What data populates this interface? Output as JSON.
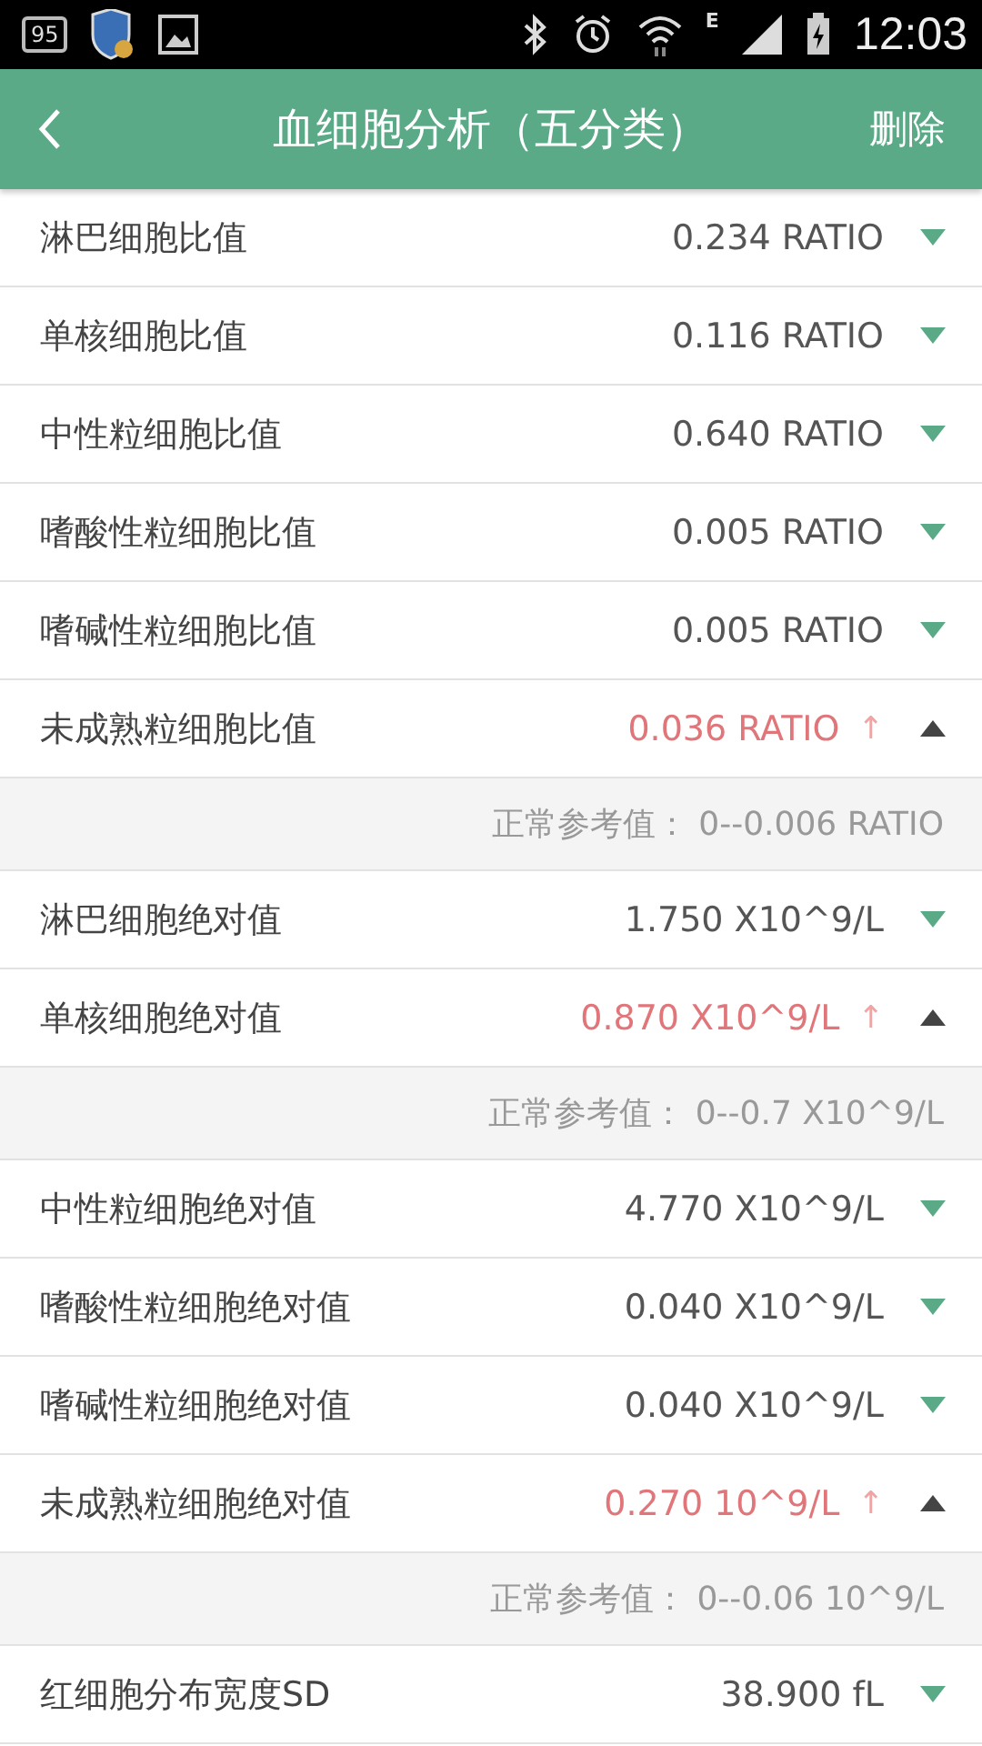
{
  "status_bar": {
    "notification_count": "95",
    "network": "E",
    "time": "12:03"
  },
  "header": {
    "title": "血细胞分析（五分类）",
    "action": "删除"
  },
  "rows": [
    {
      "name": "淋巴细胞比值",
      "value": "0.234 RATIO",
      "high": false,
      "expanded": false
    },
    {
      "name": "单核细胞比值",
      "value": "0.116 RATIO",
      "high": false,
      "expanded": false
    },
    {
      "name": "中性粒细胞比值",
      "value": "0.640 RATIO",
      "high": false,
      "expanded": false
    },
    {
      "name": "嗜酸性粒细胞比值",
      "value": "0.005 RATIO",
      "high": false,
      "expanded": false
    },
    {
      "name": "嗜碱性粒细胞比值",
      "value": "0.005 RATIO",
      "high": false,
      "expanded": false
    },
    {
      "name": "未成熟粒细胞比值",
      "value": "0.036 RATIO",
      "high": true,
      "flag": "↑",
      "expanded": true,
      "reference": "正常参考值： 0--0.006 RATIO"
    },
    {
      "name": "淋巴细胞绝对值",
      "value": "1.750 X10^9/L",
      "high": false,
      "expanded": false
    },
    {
      "name": "单核细胞绝对值",
      "value": "0.870 X10^9/L",
      "high": true,
      "flag": "↑",
      "expanded": true,
      "reference": "正常参考值： 0--0.7 X10^9/L"
    },
    {
      "name": "中性粒细胞绝对值",
      "value": "4.770 X10^9/L",
      "high": false,
      "expanded": false
    },
    {
      "name": "嗜酸性粒细胞绝对值",
      "value": "0.040 X10^9/L",
      "high": false,
      "expanded": false
    },
    {
      "name": "嗜碱性粒细胞绝对值",
      "value": "0.040 X10^9/L",
      "high": false,
      "expanded": false
    },
    {
      "name": "未成熟粒细胞绝对值",
      "value": "0.270 10^9/L",
      "high": true,
      "flag": "↑",
      "expanded": true,
      "reference": "正常参考值： 0--0.06 10^9/L"
    },
    {
      "name": "红细胞分布宽度SD",
      "value": "38.900 fL",
      "high": false,
      "expanded": false
    }
  ]
}
